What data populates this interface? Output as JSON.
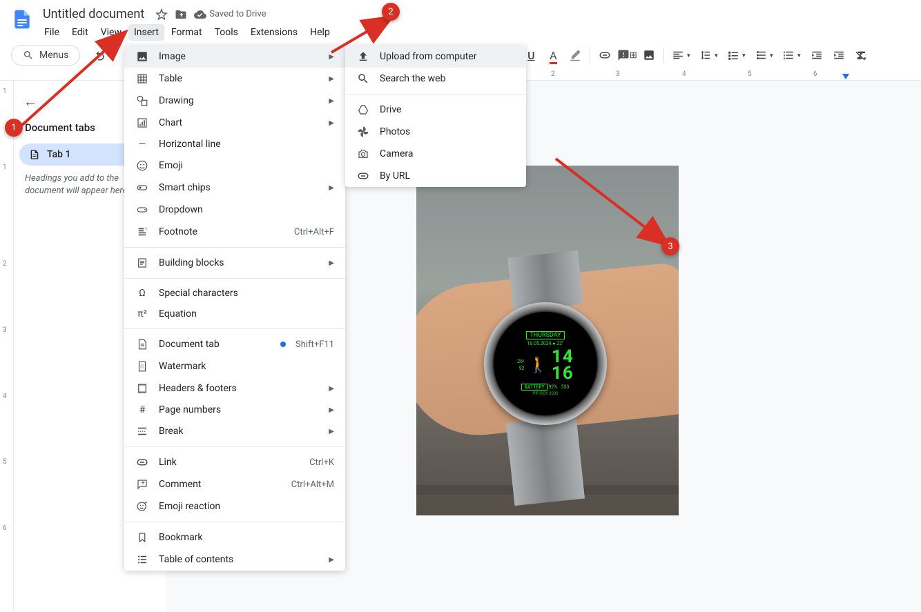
{
  "header": {
    "title": "Untitled document",
    "saved": "Saved to Drive"
  },
  "menubar": {
    "file": "File",
    "edit": "Edit",
    "view": "View",
    "insert": "Insert",
    "format": "Format",
    "tools": "Tools",
    "extensions": "Extensions",
    "help": "Help"
  },
  "toolbar": {
    "menus": "Menus"
  },
  "sidebar": {
    "title": "Document tabs",
    "tab1": "Tab 1",
    "hint": "Headings you add to the document will appear here."
  },
  "insert_menu": {
    "image": "Image",
    "table": "Table",
    "drawing": "Drawing",
    "chart": "Chart",
    "hline": "Horizontal line",
    "emoji": "Emoji",
    "chips": "Smart chips",
    "dropdown": "Dropdown",
    "footnote": "Footnote",
    "footnote_sc": "Ctrl+Alt+F",
    "blocks": "Building blocks",
    "special": "Special characters",
    "equation": "Equation",
    "doctab": "Document tab",
    "doctab_sc": "Shift+F11",
    "watermark": "Watermark",
    "headers": "Headers & footers",
    "pagenums": "Page numbers",
    "break": "Break",
    "link": "Link",
    "link_sc": "Ctrl+K",
    "comment": "Comment",
    "comment_sc": "Ctrl+Alt+M",
    "emojireact": "Emoji reaction",
    "bookmark": "Bookmark",
    "toc": "Table of contents"
  },
  "image_menu": {
    "upload": "Upload from computer",
    "search": "Search the web",
    "drive": "Drive",
    "photos": "Photos",
    "camera": "Camera",
    "byurl": "By URL"
  },
  "ruler_h": {
    "t1": "2",
    "t2": "3",
    "t3": "4",
    "t4": "5",
    "t5": "6"
  },
  "ruler_v": {
    "t0": "1",
    "t1": "1",
    "t2": "2",
    "t3": "3",
    "t4": "4",
    "t5": "5",
    "t6": "6"
  },
  "watch": {
    "day": "THURSDAY",
    "date": "16.05.2024",
    "temp": "22°",
    "time1": "14",
    "time2": "16",
    "steps": "26",
    "hr": "92",
    "bat_lbl": "BATTERY",
    "bat_val": "92%",
    "cal": "533",
    "pipboy": "PIP-BOY 3000"
  },
  "annotations": {
    "a1": "1",
    "a2": "2",
    "a3": "3"
  }
}
